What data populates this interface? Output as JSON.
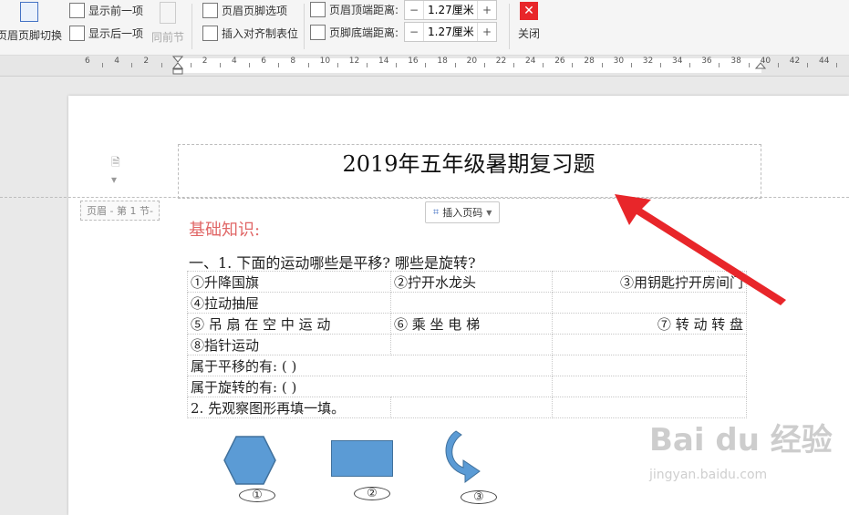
{
  "toolbar": {
    "switch_label": "页眉页脚切换",
    "show_prev": "显示前一项",
    "show_next": "显示后一项",
    "same_as_prev": "同前节",
    "hf_options": "页眉页脚选项",
    "insert_tab": "插入对齐制表位",
    "header_top_label": "页眉顶端距离:",
    "header_top_value": "1.27厘米",
    "footer_bottom_label": "页脚底端距离:",
    "footer_bottom_value": "1.27厘米",
    "close_label": "关闭",
    "minus": "−",
    "plus": "+"
  },
  "ruler": {
    "numbers": [
      "6",
      "4",
      "2",
      "",
      "2",
      "4",
      "6",
      "8",
      "10",
      "12",
      "14",
      "16",
      "18",
      "20",
      "22",
      "24",
      "26",
      "28",
      "30",
      "32",
      "34",
      "36",
      "38",
      "40",
      "42",
      "44"
    ]
  },
  "document": {
    "header_title": "2019年五年级暑期复习题",
    "header_section_label": "页眉 - 第 1 节-",
    "insert_page_number": "插入页码",
    "section_heading": "基础知识:",
    "question_1": "一、1. 下面的运动哪些是平移? 哪些是旋转?",
    "table_rows": [
      [
        "①升降国旗",
        "②拧开水龙头",
        "③用钥匙拧开房间门"
      ],
      [
        "④拉动抽屉",
        "",
        ""
      ],
      [
        "⑤ 吊 扇 在 空 中 运 动",
        "⑥ 乘 坐 电 梯",
        "⑦ 转 动 转 盘"
      ],
      [
        "⑧指针运动",
        "",
        ""
      ],
      [
        "属于平移的有:  (                    )",
        "",
        ""
      ],
      [
        "属于旋转的有: (                   )",
        "",
        ""
      ],
      [
        "2.  先观察图形再填一填。",
        "",
        ""
      ]
    ],
    "shape_labels": [
      "①",
      "②",
      "③"
    ]
  },
  "watermark": {
    "brand": "Bai du 经验",
    "url": "jingyan.baidu.com"
  },
  "colors": {
    "accent_red": "#e8262a",
    "shape_blue": "#5b9bd5",
    "heading_red": "#e06666"
  }
}
